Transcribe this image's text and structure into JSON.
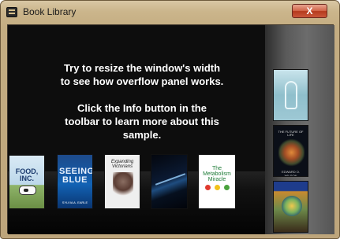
{
  "window": {
    "title": "Book Library",
    "close_label": "X"
  },
  "main": {
    "info_line_1": "Try to resize the window's width",
    "info_line_2": "to see how overflow panel works.",
    "info_line_3": "Click the Info button in the",
    "info_line_4": "toolbar  to learn more about this",
    "info_line_5": "sample."
  },
  "books": [
    {
      "title": "FOOD, INC."
    },
    {
      "title": "SEEING BLUE",
      "author": "SYLVIA A. EARLE"
    },
    {
      "title": "Expanding Victorians"
    },
    {
      "title": ""
    },
    {
      "title": "The Metabolism Miracle"
    }
  ],
  "overflow_books": [
    {
      "title": ""
    },
    {
      "title": "THE FUTURE OF LIFE",
      "author": "EDWARD O. WILSON"
    },
    {
      "title": ""
    }
  ],
  "colors": {
    "frame": "#c4ad82",
    "client_background": "#0d0d0d",
    "info_text": "#ffffff",
    "overflow_panel": "#5a5a5a",
    "close_button": "#c9563a"
  }
}
